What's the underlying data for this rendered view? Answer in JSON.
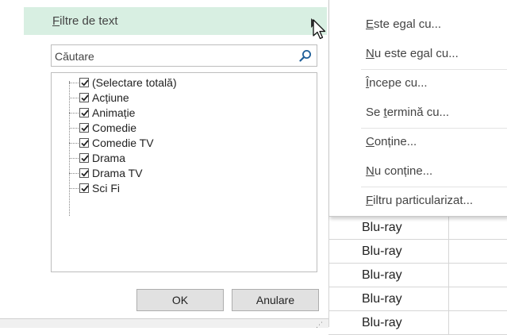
{
  "filter_panel": {
    "header": {
      "underline_char": "F",
      "label_rest": "iltre de text"
    },
    "search": {
      "placeholder": "Căutare",
      "icon": "search-icon"
    },
    "items": [
      {
        "label": "(Selectare totală)",
        "checked": true
      },
      {
        "label": "Acțiune",
        "checked": true
      },
      {
        "label": "Animație",
        "checked": true
      },
      {
        "label": "Comedie",
        "checked": true
      },
      {
        "label": "Comedie TV",
        "checked": true
      },
      {
        "label": "Drama",
        "checked": true
      },
      {
        "label": "Drama TV",
        "checked": true
      },
      {
        "label": "Sci Fi",
        "checked": true
      }
    ],
    "ok_label": "OK",
    "cancel_label": "Anulare"
  },
  "submenu": {
    "items": [
      {
        "pre": "",
        "u": "E",
        "post": "ste egal cu..."
      },
      {
        "pre": "",
        "u": "N",
        "post": "u este egal cu..."
      },
      {
        "pre": "",
        "u": "Î",
        "post": "ncepe cu..."
      },
      {
        "pre": "Se ",
        "u": "t",
        "post": "ermină cu..."
      },
      {
        "pre": "",
        "u": "C",
        "post": "onține..."
      },
      {
        "pre": "",
        "u": "N",
        "post": "u conține..."
      },
      {
        "pre": "",
        "u": "F",
        "post": "iltru particularizat..."
      }
    ]
  },
  "cells": [
    "Blu-ray",
    "Blu-ray",
    "Blu-ray",
    "Blu-ray",
    "Blu-ray"
  ],
  "colors": {
    "header_highlight": "#d8efe2",
    "button_bg": "#e1e1e1",
    "search_icon": "#1f5f99"
  }
}
